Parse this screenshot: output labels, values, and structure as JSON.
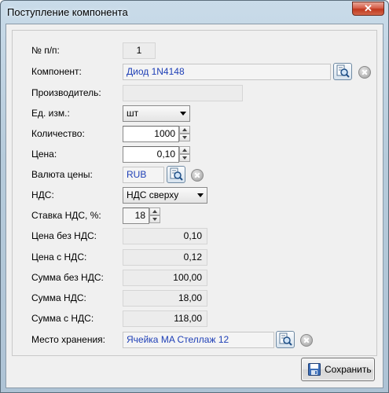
{
  "window": {
    "title": "Поступление компонента",
    "close_glyph": "✕"
  },
  "fields": {
    "number": {
      "label": "№ п/п:",
      "value": "1"
    },
    "component": {
      "label": "Компонент:",
      "value": "Диод 1N4148"
    },
    "manufacturer": {
      "label": "Производитель:",
      "value": ""
    },
    "unit": {
      "label": "Ед. изм.:",
      "value": "шт"
    },
    "quantity": {
      "label": "Количество:",
      "value": "1000"
    },
    "price": {
      "label": "Цена:",
      "value": "0,10"
    },
    "currency": {
      "label": "Валюта цены:",
      "value": "RUB"
    },
    "vat": {
      "label": "НДС:",
      "value": "НДС сверху"
    },
    "vat_rate": {
      "label": "Ставка НДС, %:",
      "value": "18"
    },
    "price_no_vat": {
      "label": "Цена без НДС:",
      "value": "0,10"
    },
    "price_vat": {
      "label": "Цена с НДС:",
      "value": "0,12"
    },
    "sum_no_vat": {
      "label": "Сумма без НДС:",
      "value": "100,00"
    },
    "sum_vat": {
      "label": "Сумма НДС:",
      "value": "18,00"
    },
    "sum_with_vat": {
      "label": "Сумма с НДС:",
      "value": "118,00"
    },
    "storage": {
      "label": "Место хранения:",
      "value": "Ячейка MA Стеллаж 12"
    }
  },
  "buttons": {
    "save_label": "Сохранить"
  },
  "icons": {
    "lookup": "lookup-icon",
    "clear": "clear-icon",
    "save": "floppy-icon"
  },
  "colors": {
    "link_text": "#1e3fb6",
    "close_button": "#c0381e"
  }
}
